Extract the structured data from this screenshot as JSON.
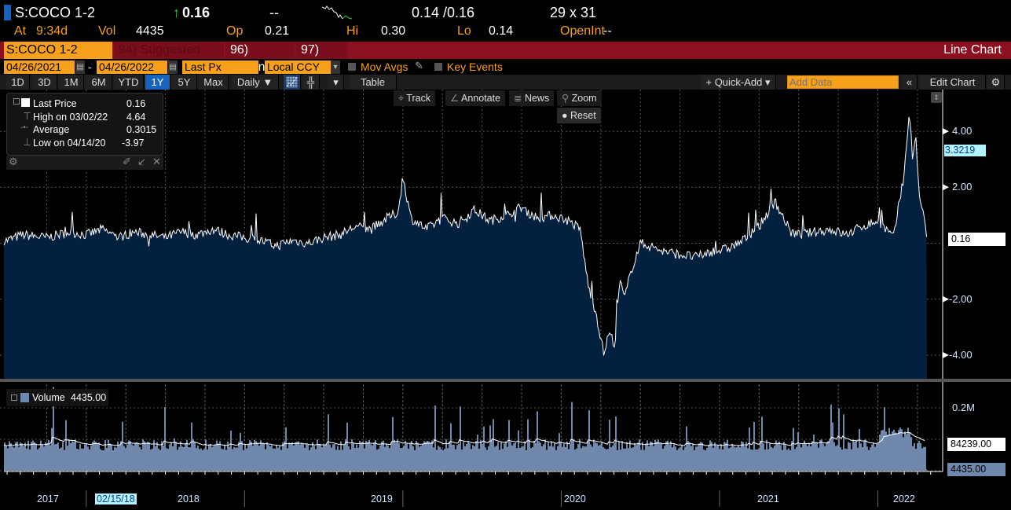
{
  "quote": {
    "ticker": "S:COCO 1-2",
    "last": "0.16",
    "change": "--",
    "bid_ask": "0.14 /0.16",
    "size": "29 x 31",
    "at_label": "At",
    "time": "9:34d",
    "vol_label": "Vol",
    "vol": "4435",
    "op_label": "Op",
    "op": "0.21",
    "hi_label": "Hi",
    "hi": "0.30",
    "lo_label": "Lo",
    "lo": "0.14",
    "openint_label": "OpenInt",
    "openint": "--"
  },
  "menubar": {
    "security": "S:COCO 1-2 Comdty",
    "suggested": "94) Suggested Charts",
    "actions": "96) Actions ▾",
    "edit": "97) Edit ▾",
    "chart_type": "Line Chart"
  },
  "params": {
    "start_date": "04/26/2021",
    "dash": "-",
    "end_date": "04/26/2022",
    "field": "Last Px",
    "currency": "Local CCY",
    "mov_avgs": "Mov Avgs",
    "key_events": "Key Events"
  },
  "toolbar": {
    "periods": [
      "1D",
      "3D",
      "1M",
      "6M",
      "YTD",
      "1Y",
      "5Y",
      "Max"
    ],
    "active_period": "1Y",
    "frequency": "Daily ▼",
    "table": "Table",
    "quick_add": "+ Quick-Add ▾",
    "add_data_placeholder": "Add Data",
    "edit_chart": "Edit Chart"
  },
  "overlay_tools": {
    "track": "Track",
    "annotate": "Annotate",
    "news": "News",
    "zoom": "Zoom",
    "reset": "Reset"
  },
  "legend": {
    "last_price_label": "Last Price",
    "last_price": "0.16",
    "high_label": "High on 03/02/22",
    "high": "4.64",
    "average_label": "Average",
    "average": "0.3015",
    "low_label": "Low on 04/14/20",
    "low": "-3.97"
  },
  "volume_legend": {
    "label": "Volume",
    "value": "4435.00"
  },
  "colors": {
    "accent_orange": "#f7a01c",
    "bar_red": "#8b1020",
    "area_fill": "#04203f",
    "volume_fill": "#7088ab",
    "active_blue": "#1565c0"
  },
  "chart_data": [
    {
      "type": "area",
      "title": "S:COCO 1-2 Comdty Last Price",
      "x": [
        2016.5,
        2016.6,
        2016.75,
        2016.9,
        2017.0,
        2017.1,
        2017.2,
        2017.3,
        2017.4,
        2017.5,
        2017.6,
        2017.7,
        2017.8,
        2017.9,
        2018.0,
        2018.1,
        2018.2,
        2018.3,
        2018.4,
        2018.5,
        2018.6,
        2018.7,
        2018.8,
        2018.9,
        2018.97,
        2019.0,
        2019.05,
        2019.15,
        2019.25,
        2019.35,
        2019.45,
        2019.55,
        2019.65,
        2019.75,
        2019.85,
        2019.95,
        2020.05,
        2020.12,
        2020.17,
        2020.22,
        2020.27,
        2020.3,
        2020.34,
        2020.37,
        2020.4,
        2020.44,
        2020.5,
        2020.56,
        2020.65,
        2020.75,
        2020.85,
        2020.95,
        2021.05,
        2021.15,
        2021.25,
        2021.35,
        2021.45,
        2021.5,
        2021.6,
        2021.7,
        2021.8,
        2021.9,
        2022.0,
        2022.05,
        2022.1,
        2022.13,
        2022.16,
        2022.18,
        2022.2,
        2022.22,
        2022.24,
        2022.26,
        2022.28,
        2022.3,
        2022.31
      ],
      "y": [
        0.1,
        0.3,
        0.2,
        0.4,
        0.3,
        0.5,
        0.2,
        0.4,
        0.3,
        0.2,
        0.4,
        0.3,
        0.5,
        0.3,
        0.2,
        0.1,
        -0.1,
        0.1,
        0.0,
        0.2,
        0.3,
        0.6,
        0.5,
        0.9,
        1.1,
        2.4,
        0.9,
        0.5,
        0.9,
        0.7,
        1.2,
        0.8,
        1.0,
        1.3,
        0.9,
        1.0,
        0.8,
        0.5,
        -1.5,
        -2.5,
        -3.97,
        -3.2,
        -3.6,
        -1.3,
        -2.0,
        -1.0,
        0.0,
        -0.1,
        -0.3,
        -0.4,
        -0.5,
        -0.3,
        -0.2,
        0.1,
        0.6,
        1.5,
        0.4,
        0.3,
        0.4,
        0.5,
        0.3,
        0.6,
        0.8,
        0.5,
        0.2,
        1.3,
        2.2,
        3.5,
        4.64,
        3.0,
        3.8,
        1.8,
        1.2,
        0.6,
        0.16
      ],
      "ylim": [
        -4.8,
        5.5
      ],
      "yticks": [
        "4.00",
        "2.00",
        "-2.00",
        "-4.00"
      ],
      "ytick_values": [
        4,
        2,
        -2,
        -4
      ],
      "last_label": "0.16",
      "marker_label": "3.3219"
    },
    {
      "type": "bar",
      "title": "Volume",
      "last_volume": 4435,
      "moving_average": 84239,
      "ylim": [
        0,
        300000
      ],
      "yticks": [
        "0.2M"
      ],
      "ytick_values": [
        200000
      ],
      "last_label": "4435.00",
      "ma_label": "84239.00"
    }
  ],
  "xaxis": {
    "years": [
      "2017",
      "2018",
      "2019",
      "2020",
      "2021",
      "2022"
    ],
    "cursor_date": "02/15/18"
  }
}
